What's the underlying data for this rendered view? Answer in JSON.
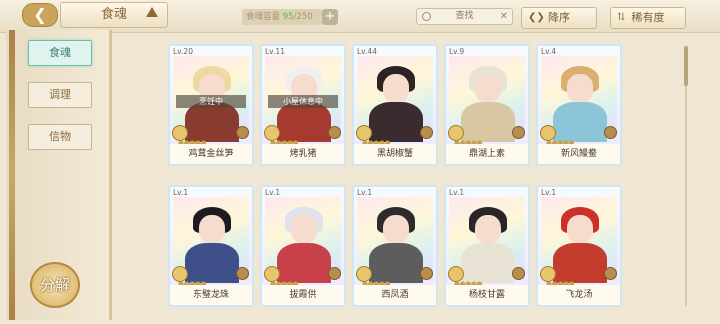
{
  "header": {
    "title": "食魂",
    "capacity_label": "食魂容量",
    "capacity_current": "95",
    "capacity_max": "/250",
    "search_placeholder": "查找",
    "sort_order": "降序",
    "sort_rarity": "稀有度"
  },
  "sidebar": {
    "items": [
      {
        "label": "食魂"
      },
      {
        "label": "调理"
      },
      {
        "label": "信物"
      }
    ],
    "decompose_label": "分解"
  },
  "cards": [
    {
      "level": "Lv.20",
      "name": "鸡茸金丝笋",
      "status": "烹饪中",
      "hair": "#efd9a2",
      "body": "#8a3b2f"
    },
    {
      "level": "Lv.11",
      "name": "烤乳猪",
      "status": "小屋休息中",
      "hair": "#f0f0f0",
      "body": "#a63a2e"
    },
    {
      "level": "Lv.44",
      "name": "黑胡椒蟹",
      "status": "",
      "hair": "#2c2424",
      "body": "#3a2b2e"
    },
    {
      "level": "Lv.9",
      "name": "鼎湖上素",
      "status": "",
      "hair": "#e9e3d2",
      "body": "#d8c7a2"
    },
    {
      "level": "Lv.4",
      "name": "新风鳗鲞",
      "status": "",
      "hair": "#d9b070",
      "body": "#8cc5d8"
    },
    {
      "level": "Lv.1",
      "name": "东璧龙珠",
      "status": "",
      "hair": "#1e1a22",
      "body": "#3f4f8a"
    },
    {
      "level": "Lv.1",
      "name": "拔霞供",
      "status": "",
      "hair": "#dfe2ea",
      "body": "#c8404a"
    },
    {
      "level": "Lv.1",
      "name": "西凤酒",
      "status": "",
      "hair": "#2d2b2b",
      "body": "#5d5d5d"
    },
    {
      "level": "Lv.1",
      "name": "杨枝甘露",
      "status": "",
      "hair": "#2a2628",
      "body": "#e9e3d6"
    },
    {
      "level": "Lv.1",
      "name": "飞龙汤",
      "status": "",
      "hair": "#c9312a",
      "body": "#c33c2e"
    }
  ]
}
